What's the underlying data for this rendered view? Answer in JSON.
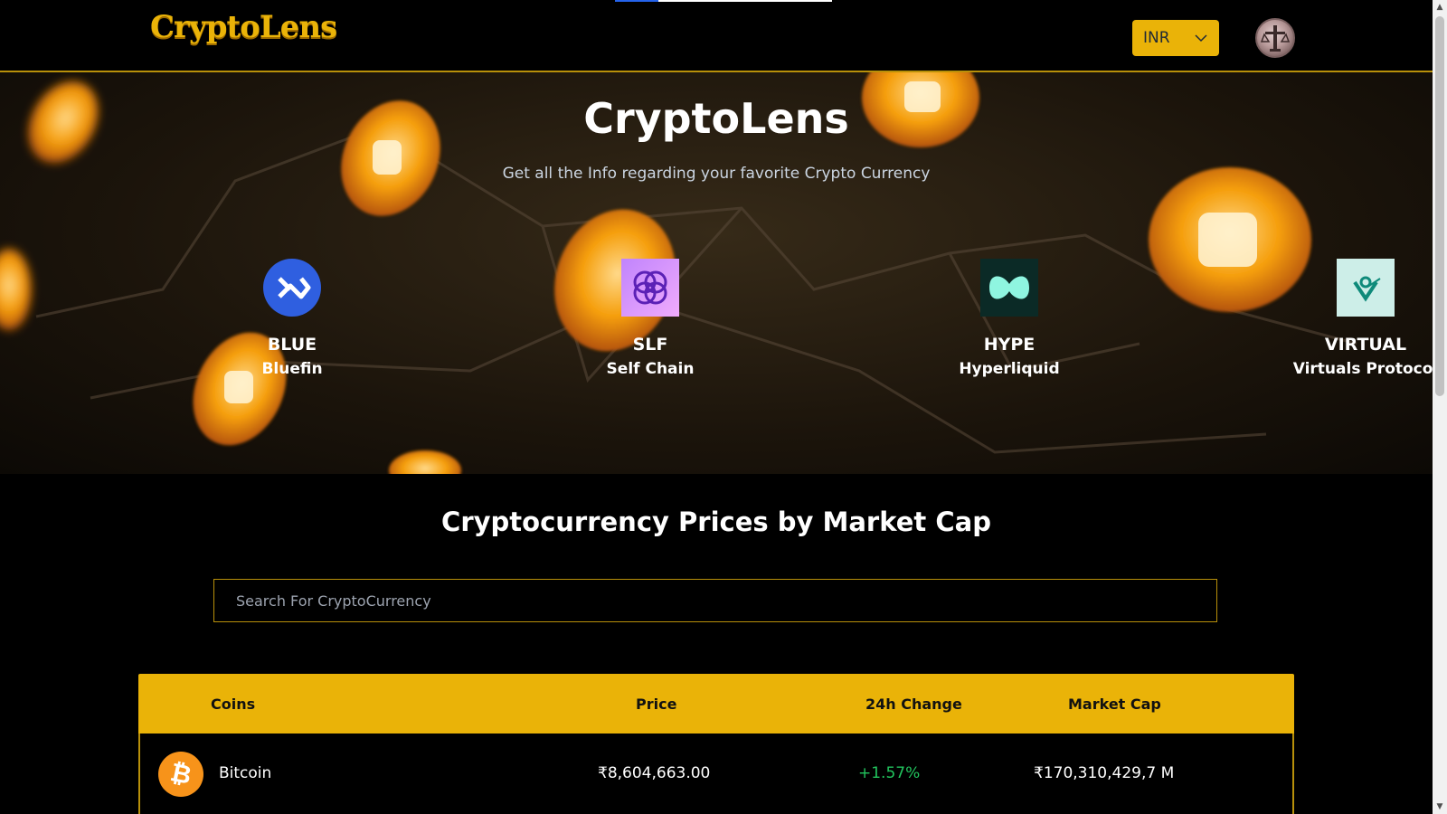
{
  "header": {
    "logo": "CryptoLens",
    "currency_selected": "INR"
  },
  "hero": {
    "title": "CryptoLens",
    "subtitle": "Get all the Info regarding your favorite Crypto Currency",
    "carousel": [
      {
        "symbol": "BLUE",
        "name": "Bluefin",
        "icon": "bluefin-logo",
        "color": "#2f5fe0"
      },
      {
        "symbol": "SLF",
        "name": "Self Chain",
        "icon": "self-chain-logo",
        "color": "#a855f7"
      },
      {
        "symbol": "HYPE",
        "name": "Hyperliquid",
        "icon": "hyperliquid-logo",
        "color": "#0b2a26"
      },
      {
        "symbol": "VIRTUAL",
        "name": "Virtuals Protocol",
        "icon": "virtuals-logo",
        "color": "#cdeee8"
      }
    ]
  },
  "market": {
    "title": "Cryptocurrency Prices by Market Cap",
    "search_placeholder": "Search For CryptoCurrency",
    "columns": [
      "Coins",
      "Price",
      "24h Change",
      "Market Cap"
    ],
    "rows": [
      {
        "name": "Bitcoin",
        "icon": "bitcoin-icon",
        "price": "₹8,604,663.00",
        "change": "+1.57%",
        "market_cap": "₹170,310,429,7 M"
      }
    ]
  },
  "colors": {
    "accent": "#eab308",
    "positive": "#22c55e",
    "background": "#000000"
  }
}
